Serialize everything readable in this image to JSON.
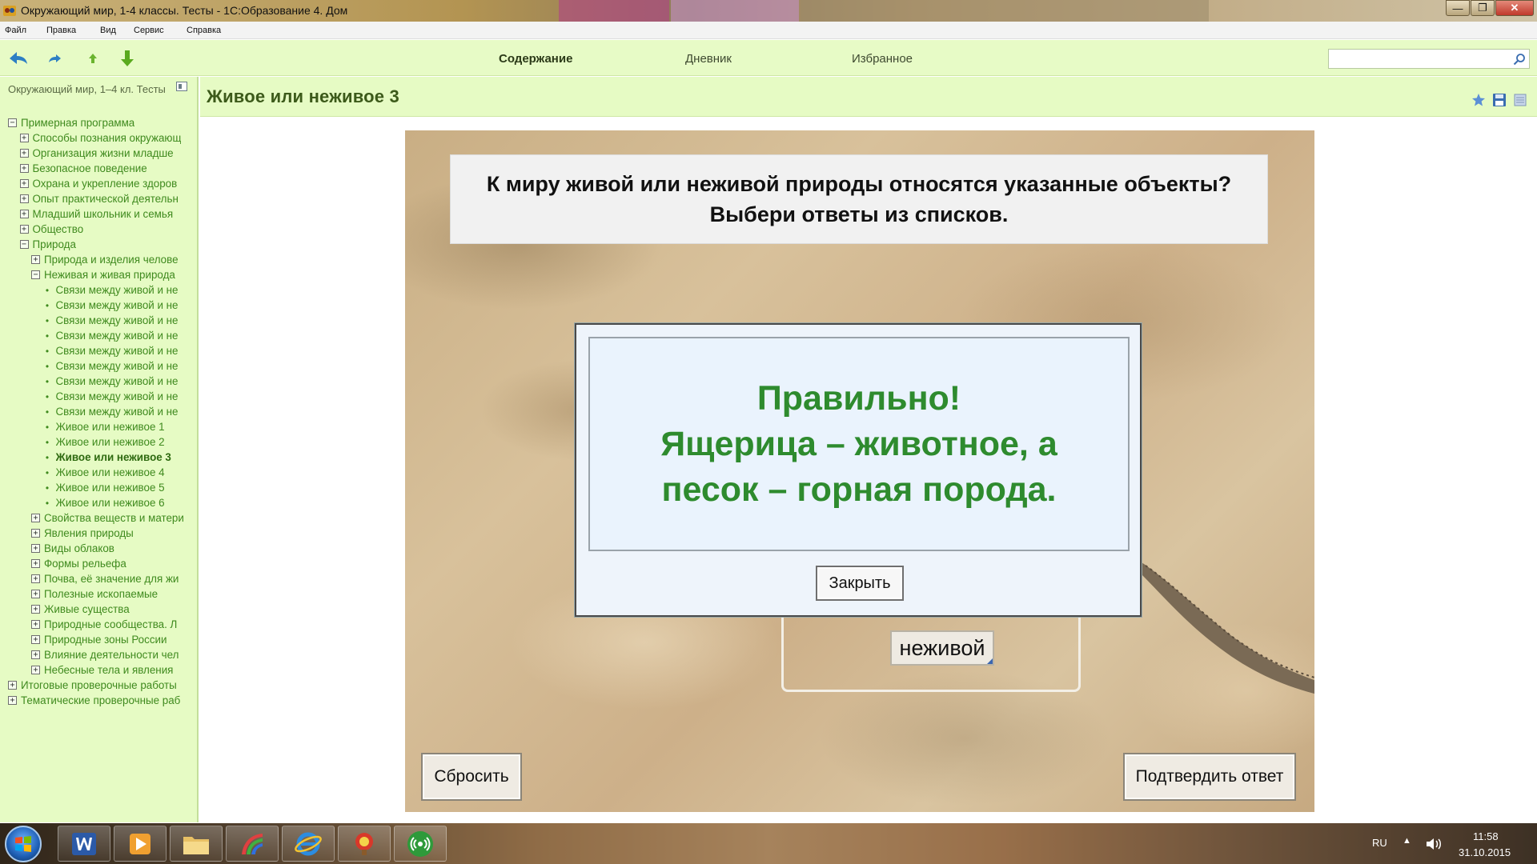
{
  "window": {
    "title": "Окружающий мир, 1-4 классы. Тесты - 1С:Образование 4. Дом",
    "controls": [
      "minimize",
      "maximize",
      "close"
    ]
  },
  "menu": [
    "Файл",
    "Правка",
    "Вид",
    "Сервис",
    "Справка"
  ],
  "toolbar": {
    "tabs": [
      {
        "label": "Содержание",
        "active": true
      },
      {
        "label": "Дневник",
        "active": false
      },
      {
        "label": "Избранное",
        "active": false
      }
    ],
    "search_value": ""
  },
  "sidebar": {
    "title": "Окружающий мир, 1–4 кл. Тесты",
    "tree": [
      {
        "level": 0,
        "type": "collapse",
        "label": "Примерная программа"
      },
      {
        "level": 1,
        "type": "expand",
        "label": "Способы познания окружающ"
      },
      {
        "level": 1,
        "type": "expand",
        "label": "Организация жизни младше"
      },
      {
        "level": 1,
        "type": "expand",
        "label": "Безопасное поведение"
      },
      {
        "level": 1,
        "type": "expand",
        "label": "Охрана и укрепление здоров"
      },
      {
        "level": 1,
        "type": "expand",
        "label": "Опыт практической деятельн"
      },
      {
        "level": 1,
        "type": "expand",
        "label": "Младший школьник и семья"
      },
      {
        "level": 1,
        "type": "expand",
        "label": "Общество"
      },
      {
        "level": 1,
        "type": "collapse",
        "label": "Природа"
      },
      {
        "level": 2,
        "type": "expand",
        "label": "Природа и изделия челове"
      },
      {
        "level": 2,
        "type": "collapse",
        "label": "Неживая и живая природа"
      },
      {
        "level": 3,
        "type": "leaf",
        "label": "Связи между живой и не"
      },
      {
        "level": 3,
        "type": "leaf",
        "label": "Связи между живой и не"
      },
      {
        "level": 3,
        "type": "leaf",
        "label": "Связи между живой и не"
      },
      {
        "level": 3,
        "type": "leaf",
        "label": "Связи между живой и не"
      },
      {
        "level": 3,
        "type": "leaf",
        "label": "Связи между живой и не"
      },
      {
        "level": 3,
        "type": "leaf",
        "label": "Связи между живой и не"
      },
      {
        "level": 3,
        "type": "leaf",
        "label": "Связи между живой и не"
      },
      {
        "level": 3,
        "type": "leaf",
        "label": "Связи между живой и не"
      },
      {
        "level": 3,
        "type": "leaf",
        "label": "Связи между живой и не"
      },
      {
        "level": 3,
        "type": "leaf",
        "label": "Живое или неживое 1"
      },
      {
        "level": 3,
        "type": "leaf",
        "label": "Живое или неживое 2"
      },
      {
        "level": 3,
        "type": "leaf",
        "label": "Живое или неживое 3",
        "selected": true
      },
      {
        "level": 3,
        "type": "leaf",
        "label": "Живое или неживое 4"
      },
      {
        "level": 3,
        "type": "leaf",
        "label": "Живое или неживое 5"
      },
      {
        "level": 3,
        "type": "leaf",
        "label": "Живое или неживое 6"
      },
      {
        "level": 2,
        "type": "expand",
        "label": "Свойства веществ и матери"
      },
      {
        "level": 2,
        "type": "expand",
        "label": "Явления природы"
      },
      {
        "level": 2,
        "type": "expand",
        "label": "Виды облаков"
      },
      {
        "level": 2,
        "type": "expand",
        "label": "Формы рельефа"
      },
      {
        "level": 2,
        "type": "expand",
        "label": "Почва, её значение для жи"
      },
      {
        "level": 2,
        "type": "expand",
        "label": "Полезные ископаемые"
      },
      {
        "level": 2,
        "type": "expand",
        "label": "Живые существа"
      },
      {
        "level": 2,
        "type": "expand",
        "label": "Природные сообщества. Л"
      },
      {
        "level": 2,
        "type": "expand",
        "label": "Природные зоны России"
      },
      {
        "level": 2,
        "type": "expand",
        "label": "Влияние деятельности чел"
      },
      {
        "level": 2,
        "type": "expand",
        "label": "Небесные тела и явления"
      },
      {
        "level": 0,
        "type": "expand",
        "label": "Итоговые проверочные работы"
      },
      {
        "level": 0,
        "type": "expand",
        "label": "Тематические проверочные раб"
      }
    ]
  },
  "content": {
    "page_title": "Живое или неживое 3",
    "question_line1": "К миру живой или неживой природы относятся указанные объекты?",
    "question_line2": "Выбери ответы из списков.",
    "answer_chip": "неживой",
    "reset_button": "Сбросить",
    "confirm_button": "Подтвердить ответ"
  },
  "dialog": {
    "line1": "Правильно!",
    "line2": "Ящерица – животное, а",
    "line3": "песок – горная порода.",
    "close_button": "Закрыть"
  },
  "taskbar": {
    "apps": [
      "start-orb",
      "word-icon",
      "media-player-icon",
      "file-explorer-icon",
      "paint-icon",
      "internet-explorer-icon",
      "1c-education-icon",
      "network-app-icon"
    ],
    "language": "RU",
    "time": "11:58",
    "date": "31.10.2015"
  },
  "colors": {
    "accent_green": "#3f8a1e",
    "toolbar_bg": "#e7fbc6",
    "success_text": "#2e8b2e"
  }
}
